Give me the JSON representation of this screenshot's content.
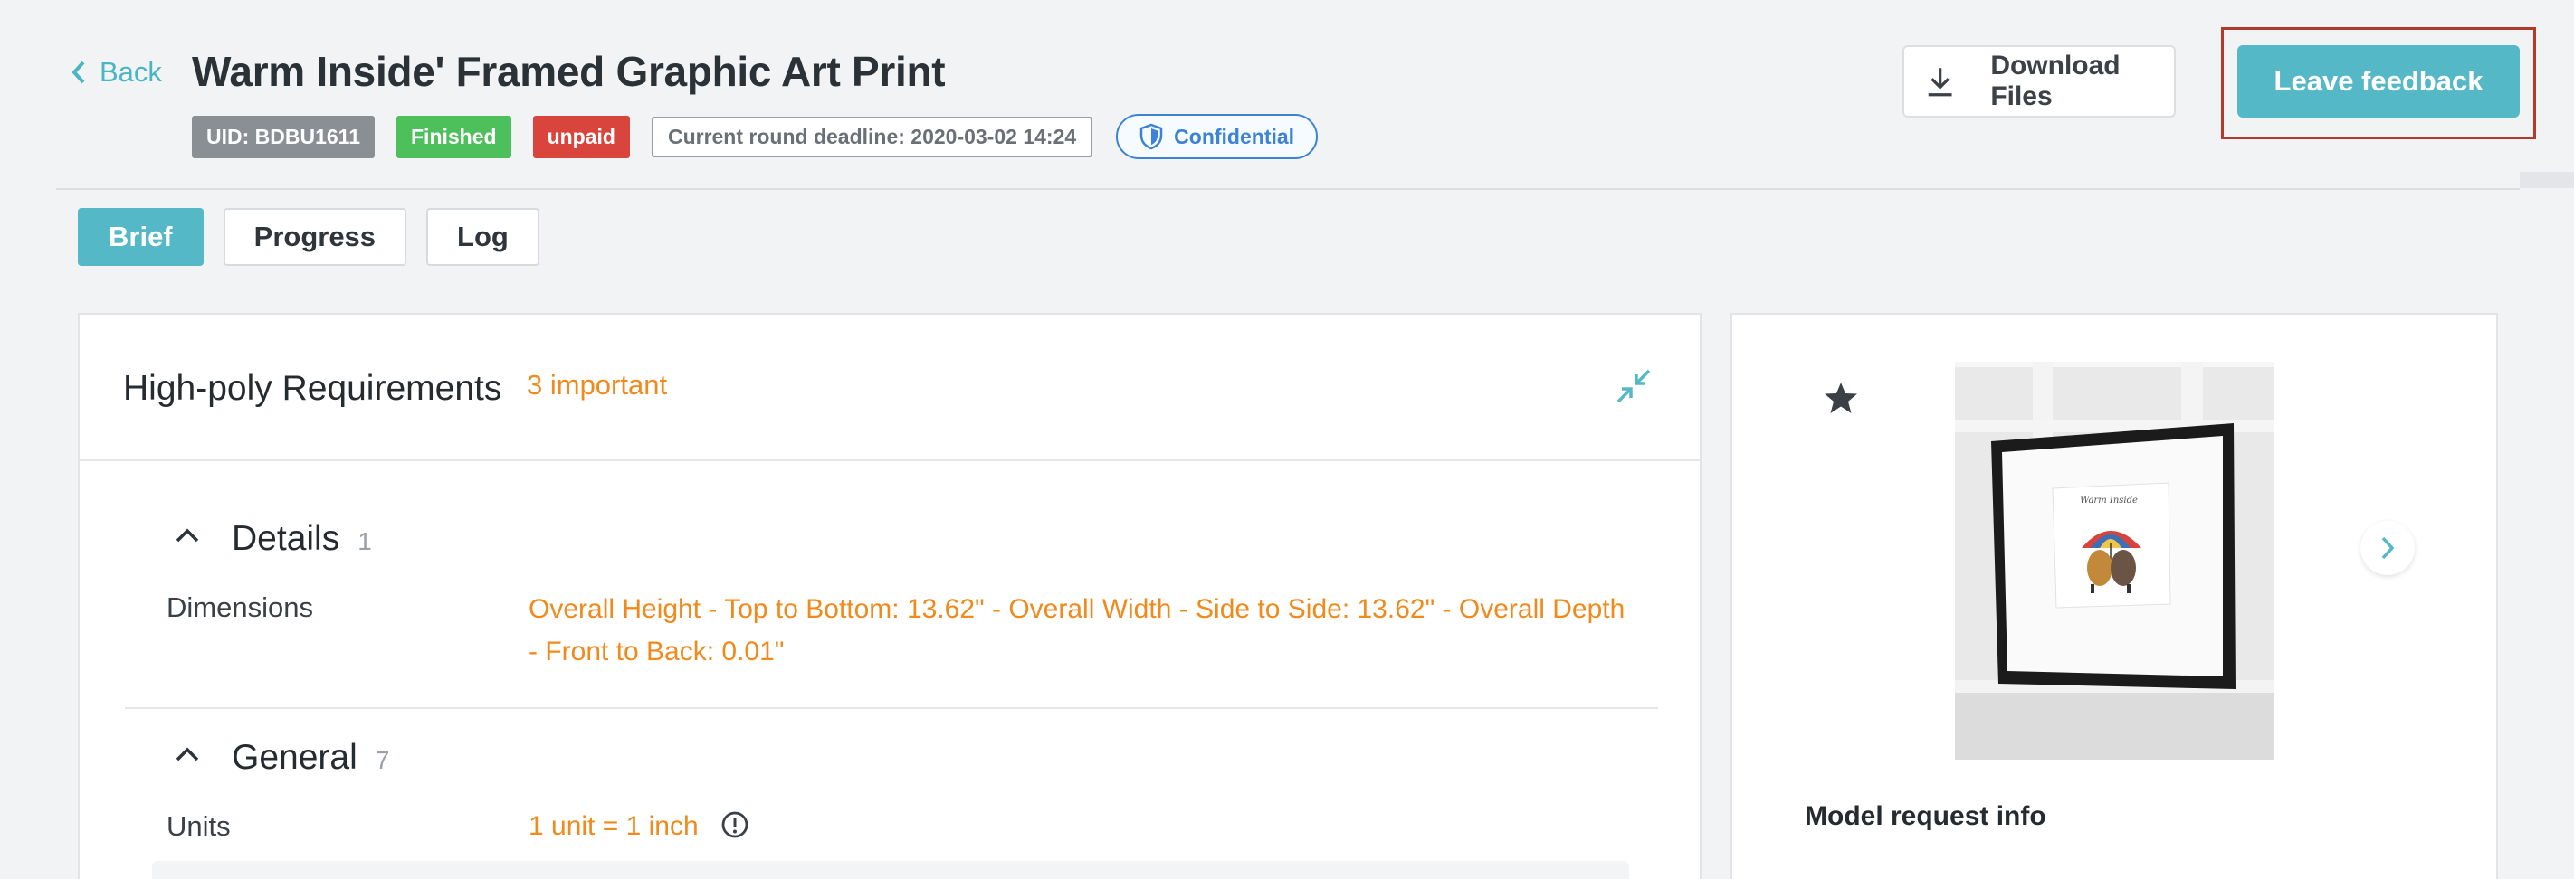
{
  "header": {
    "back_label": "Back",
    "title": "Warm Inside' Framed Graphic Art Print",
    "badges": {
      "uid": "UID: BDBU1611",
      "status": "Finished",
      "payment": "unpaid",
      "deadline": "Current round deadline: 2020-03-02 14:24",
      "confidential": "Confidential"
    },
    "download_label": "Download Files",
    "feedback_label": "Leave feedback"
  },
  "tabs": [
    {
      "label": "Brief",
      "active": true
    },
    {
      "label": "Progress",
      "active": false
    },
    {
      "label": "Log",
      "active": false
    }
  ],
  "requirements": {
    "title": "High-poly Requirements",
    "important": "3 important",
    "sections": [
      {
        "title": "Details",
        "count": "1",
        "rows": [
          {
            "label": "Dimensions",
            "value": "Overall Height - Top to Bottom: 13.62\" - Overall Width - Side to Side: 13.62\" - Overall Depth - Front to Back: 0.01\""
          }
        ]
      },
      {
        "title": "General",
        "count": "7",
        "rows": [
          {
            "label": "Units",
            "value": "1 unit = 1 inch"
          }
        ]
      }
    ]
  },
  "media": {
    "model_info_label": "Model request info",
    "print_caption": "Warm Inside"
  },
  "colors": {
    "accent": "#55b8c6",
    "important": "#f08a1c",
    "finished": "#4dc05c",
    "unpaid": "#d9453d",
    "confidential": "#3c82d6"
  }
}
